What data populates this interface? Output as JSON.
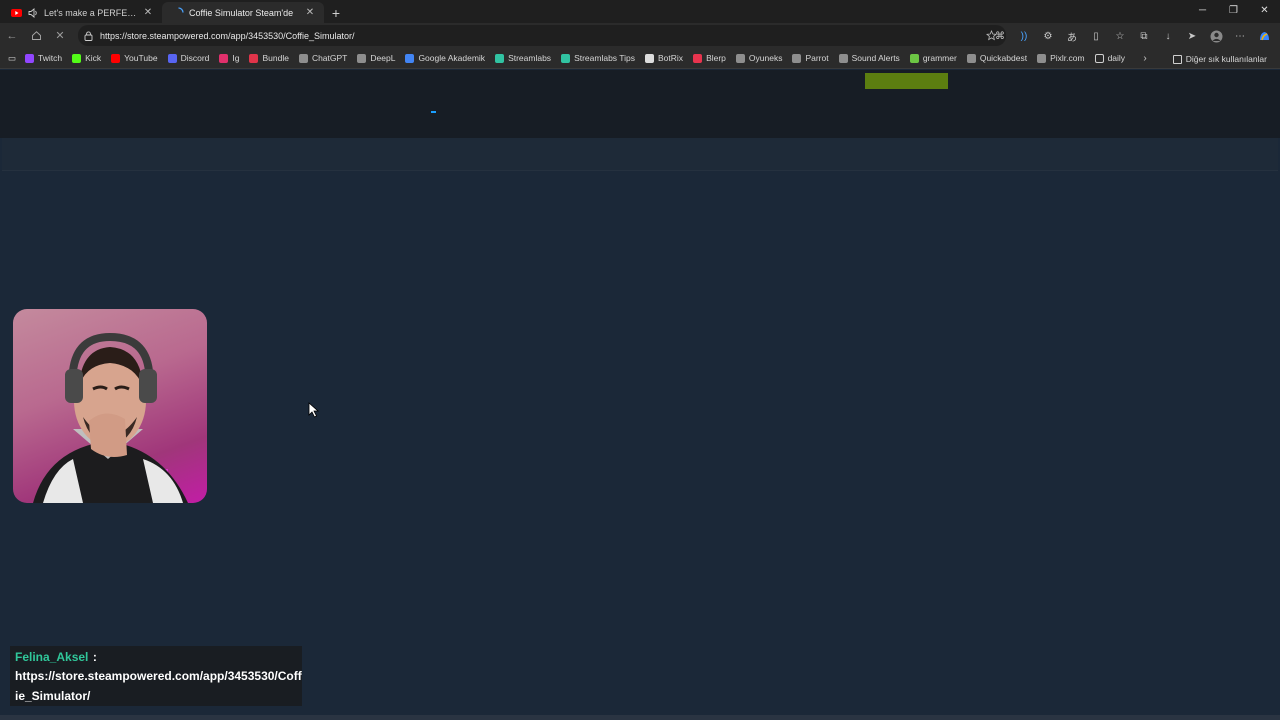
{
  "browser": {
    "tabs": [
      {
        "title": "Let's make a PERFECT iced m",
        "favicon": "youtube-icon",
        "audio": true
      },
      {
        "title": "Coffie Simulator Steam'de",
        "favicon": "loading-spinner-icon",
        "active": true
      }
    ],
    "url": "https://store.steampowered.com/app/3453530/Coffie_Simulator/"
  },
  "bookmarks": [
    {
      "label": "Twitch",
      "icon": "twitch-icon",
      "color": "#9146ff"
    },
    {
      "label": "Kick",
      "icon": "kick-icon",
      "color": "#53fc18"
    },
    {
      "label": "YouTube",
      "icon": "youtube-icon",
      "color": "#ff0000"
    },
    {
      "label": "Discord",
      "icon": "discord-icon",
      "color": "#5865f2"
    },
    {
      "label": "Ig",
      "icon": "instagram-icon",
      "color": "#e1306c"
    },
    {
      "label": "Bundle",
      "icon": "bundle-icon",
      "color": "#e0344a"
    },
    {
      "label": "ChatGPT",
      "icon": "chatgpt-icon",
      "color": "#8e8e8e"
    },
    {
      "label": "DeepL",
      "icon": "deepl-icon",
      "color": "#8e8e8e"
    },
    {
      "label": "Google Akademik",
      "icon": "scholar-icon",
      "color": "#4285f4"
    },
    {
      "label": "Streamlabs",
      "icon": "streamlabs-icon",
      "color": "#31c3a2"
    },
    {
      "label": "Streamlabs Tips",
      "icon": "streamlabs-icon",
      "color": "#31c3a2"
    },
    {
      "label": "BotRix",
      "icon": "botrix-icon",
      "color": "#dddddd"
    },
    {
      "label": "Blerp",
      "icon": "blerp-icon",
      "color": "#e8344e"
    },
    {
      "label": "Oyuneks",
      "icon": "oyuneks-icon",
      "color": "#8e8e8e"
    },
    {
      "label": "Parrot",
      "icon": "parrot-icon",
      "color": "#8e8e8e"
    },
    {
      "label": "Sound Alerts",
      "icon": "sound-alerts-icon",
      "color": "#8e8e8e"
    },
    {
      "label": "grammer",
      "icon": "grammer-icon",
      "color": "#6cc644"
    },
    {
      "label": "Quickabdest",
      "icon": "quickabdest-icon",
      "color": "#8e8e8e"
    },
    {
      "label": "Pixlr.com",
      "icon": "pixlr-icon",
      "color": "#8e8e8e"
    },
    {
      "label": "daily",
      "icon": "folder-icon",
      "color": "#8e8e8e"
    }
  ],
  "other_bookmarks": "Diğer sık kullanılanlar",
  "page": {
    "install_button_color": "#5c7e10",
    "header_color": "#171d25",
    "background": "#1b2838"
  },
  "chat": {
    "username": "Felina_Aksel",
    "username_color": "#30c79a",
    "separator": ":",
    "message": "https://store.steampowered.com/app/3453530/Coffie_Simulator/"
  }
}
